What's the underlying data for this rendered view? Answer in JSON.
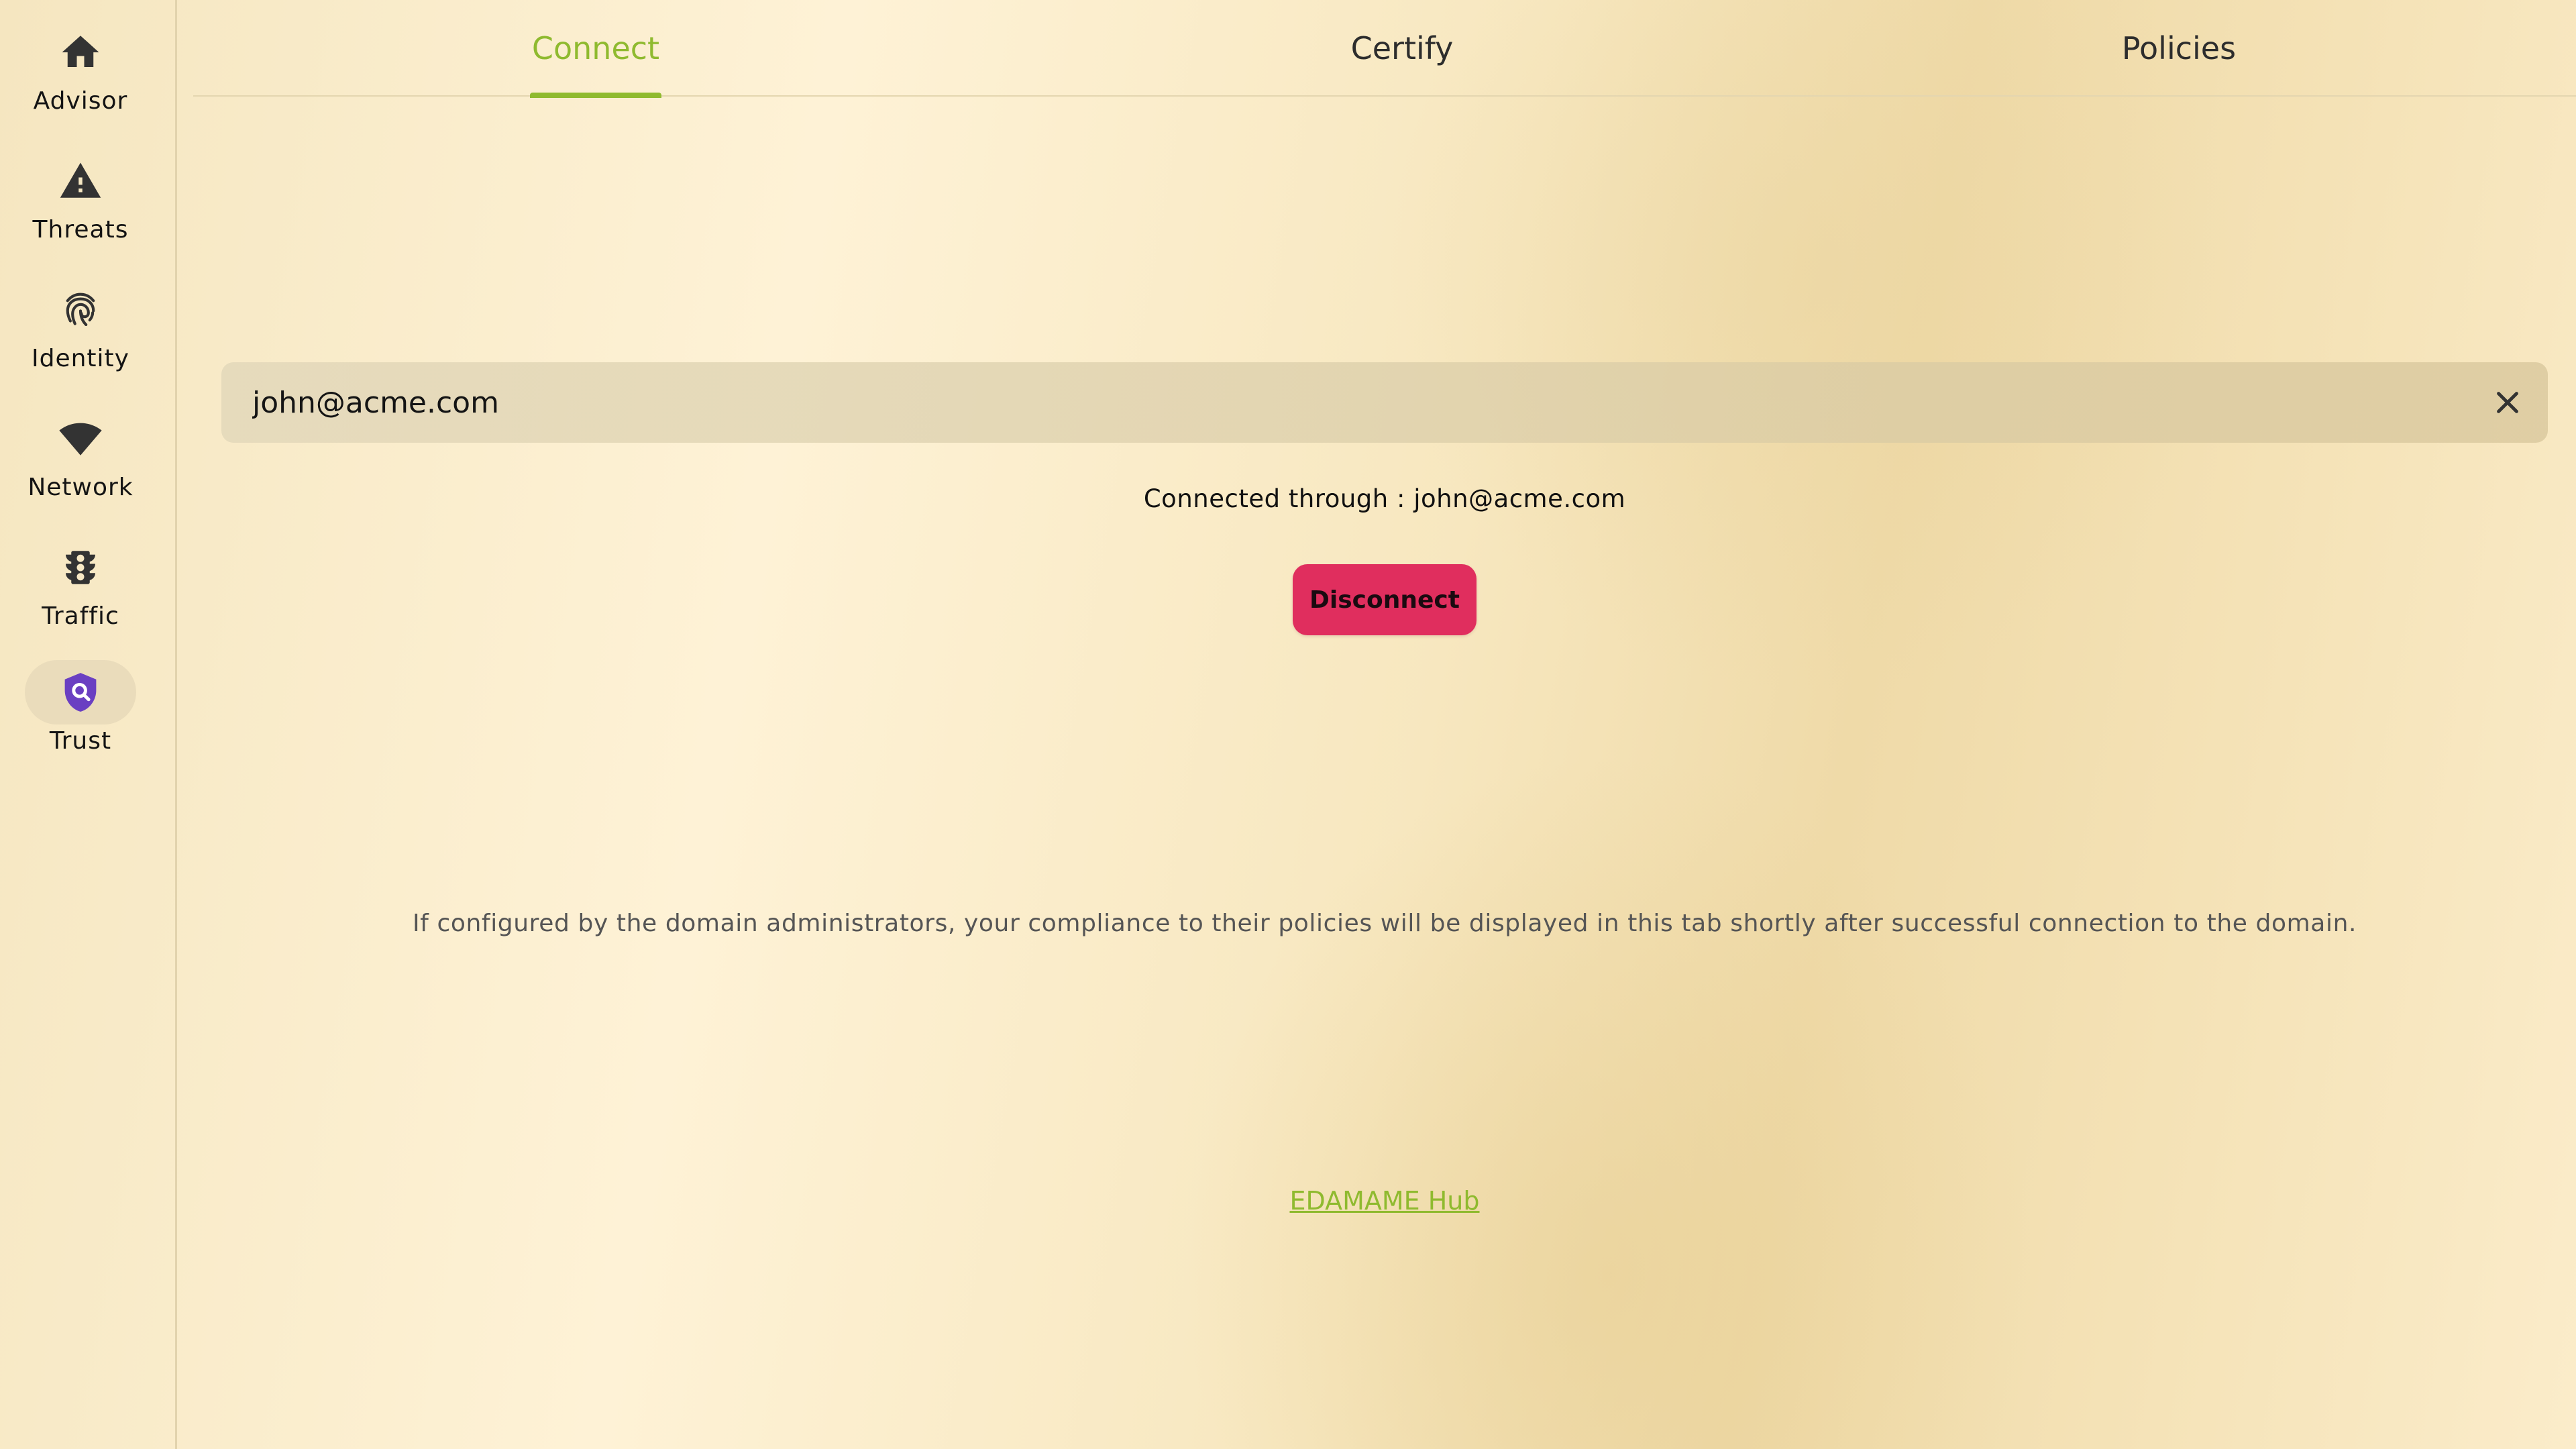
{
  "sidebar": {
    "items": [
      {
        "label": "Advisor",
        "icon": "home-icon"
      },
      {
        "label": "Threats",
        "icon": "warning-icon"
      },
      {
        "label": "Identity",
        "icon": "fingerprint-icon"
      },
      {
        "label": "Network",
        "icon": "wifi-icon"
      },
      {
        "label": "Traffic",
        "icon": "traffic-light-icon"
      },
      {
        "label": "Trust",
        "icon": "shield-search-icon",
        "active": true
      }
    ]
  },
  "tabs": [
    {
      "label": "Connect",
      "active": true
    },
    {
      "label": "Certify"
    },
    {
      "label": "Policies"
    }
  ],
  "connect": {
    "email_value": "john@acme.com",
    "status_text": "Connected through : john@acme.com",
    "disconnect_label": "Disconnect",
    "info_text": "If configured by the domain administrators, your compliance to their policies will be displayed in this tab shortly after successful connection to the domain.",
    "hub_link_label": "EDAMAME Hub"
  },
  "colors": {
    "accent": "#8fba2f",
    "danger": "#e02e5e",
    "trust_icon": "#6a3fc2",
    "icon": "#333333"
  }
}
